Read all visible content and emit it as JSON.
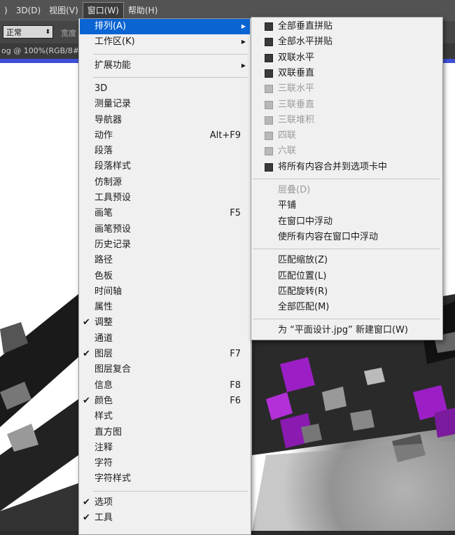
{
  "menubar": {
    "items": [
      {
        "label": ")"
      },
      {
        "label": "3D(D)"
      },
      {
        "label": "视图(V)"
      },
      {
        "label": "窗口(W)"
      },
      {
        "label": "帮助(H)"
      }
    ]
  },
  "options_bar": {
    "blend_mode": "正常",
    "label_partial": "宽度"
  },
  "document_tab": {
    "title": "og @ 100%(RGB/8#)"
  },
  "window_menu": {
    "items": [
      {
        "label": "排列(A)",
        "submenu": true,
        "highlighted": true
      },
      {
        "label": "工作区(K)",
        "submenu": true
      },
      {
        "label": "扩展功能",
        "submenu": true
      },
      {
        "label": "3D"
      },
      {
        "label": "测量记录"
      },
      {
        "label": "导航器"
      },
      {
        "label": "动作",
        "shortcut": "Alt+F9"
      },
      {
        "label": "段落"
      },
      {
        "label": "段落样式"
      },
      {
        "label": "仿制源"
      },
      {
        "label": "工具预设"
      },
      {
        "label": "画笔",
        "shortcut": "F5"
      },
      {
        "label": "画笔预设"
      },
      {
        "label": "历史记录"
      },
      {
        "label": "路径"
      },
      {
        "label": "色板"
      },
      {
        "label": "时间轴"
      },
      {
        "label": "属性"
      },
      {
        "label": "调整",
        "checked": true
      },
      {
        "label": "通道"
      },
      {
        "label": "图层",
        "shortcut": "F7",
        "checked": true
      },
      {
        "label": "图层复合"
      },
      {
        "label": "信息",
        "shortcut": "F8"
      },
      {
        "label": "颜色",
        "shortcut": "F6",
        "checked": true
      },
      {
        "label": "样式"
      },
      {
        "label": "直方图"
      },
      {
        "label": "注释"
      },
      {
        "label": "字符"
      },
      {
        "label": "字符样式"
      },
      {
        "label": "选项",
        "checked": true
      },
      {
        "label": "工具",
        "checked": true
      }
    ],
    "check_mark": "✔",
    "submenu_arrow": "▶"
  },
  "arrange_submenu": {
    "items": [
      {
        "label": "全部垂直拼贴",
        "icon": "tile-vertical-icon"
      },
      {
        "label": "全部水平拼贴",
        "icon": "tile-horizontal-icon"
      },
      {
        "label": "双联水平",
        "icon": "two-up-horizontal-icon"
      },
      {
        "label": "双联垂直",
        "icon": "two-up-vertical-icon"
      },
      {
        "label": "三联水平",
        "icon": "three-up-horizontal-icon",
        "disabled": true
      },
      {
        "label": "三联垂直",
        "icon": "three-up-vertical-icon",
        "disabled": true
      },
      {
        "label": "三联堆积",
        "icon": "three-up-stacked-icon",
        "disabled": true
      },
      {
        "label": "四联",
        "icon": "four-up-icon",
        "disabled": true
      },
      {
        "label": "六联",
        "icon": "six-up-icon",
        "disabled": true
      },
      {
        "label": "将所有内容合并到选项卡中",
        "icon": "consolidate-tabs-icon"
      },
      {
        "label": "层叠(D)",
        "disabled": true
      },
      {
        "label": "平铺"
      },
      {
        "label": "在窗口中浮动"
      },
      {
        "label": "使所有内容在窗口中浮动"
      },
      {
        "label": "匹配缩放(Z)"
      },
      {
        "label": "匹配位置(L)"
      },
      {
        "label": "匹配旋转(R)"
      },
      {
        "label": "全部匹配(M)"
      },
      {
        "label": "为 “平面设计.jpg” 新建窗口(W)"
      }
    ]
  },
  "colors": {
    "highlight": "#0a64d2",
    "accent_purple": "#9b1fc4",
    "menu_bg": "#f0f0f0",
    "blue_bar": "#3f4fd6"
  }
}
